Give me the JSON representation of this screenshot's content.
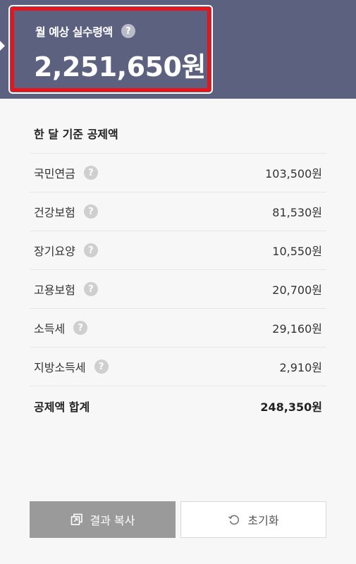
{
  "header": {
    "label": "월 예상 실수령액",
    "help_icon": "?",
    "amount": "2,251,650원"
  },
  "deductions": {
    "title": "한 달 기준 공제액",
    "items": [
      {
        "label": "국민연금",
        "help_icon": "?",
        "amount": "103,500원"
      },
      {
        "label": "건강보험",
        "help_icon": "?",
        "amount": "81,530원"
      },
      {
        "label": "장기요양",
        "help_icon": "?",
        "amount": "10,550원"
      },
      {
        "label": "고용보험",
        "help_icon": "?",
        "amount": "20,700원"
      },
      {
        "label": "소득세",
        "help_icon": "?",
        "amount": "29,160원"
      },
      {
        "label": "지방소득세",
        "help_icon": "?",
        "amount": "2,910원"
      }
    ],
    "total_label": "공제액 합계",
    "total_amount": "248,350원"
  },
  "buttons": {
    "copy_label": "결과 복사",
    "reset_label": "초기화"
  },
  "colors": {
    "header_bg": "#5d6180",
    "highlight": "#e8141b",
    "copy_button_bg": "#9a9a9a"
  }
}
